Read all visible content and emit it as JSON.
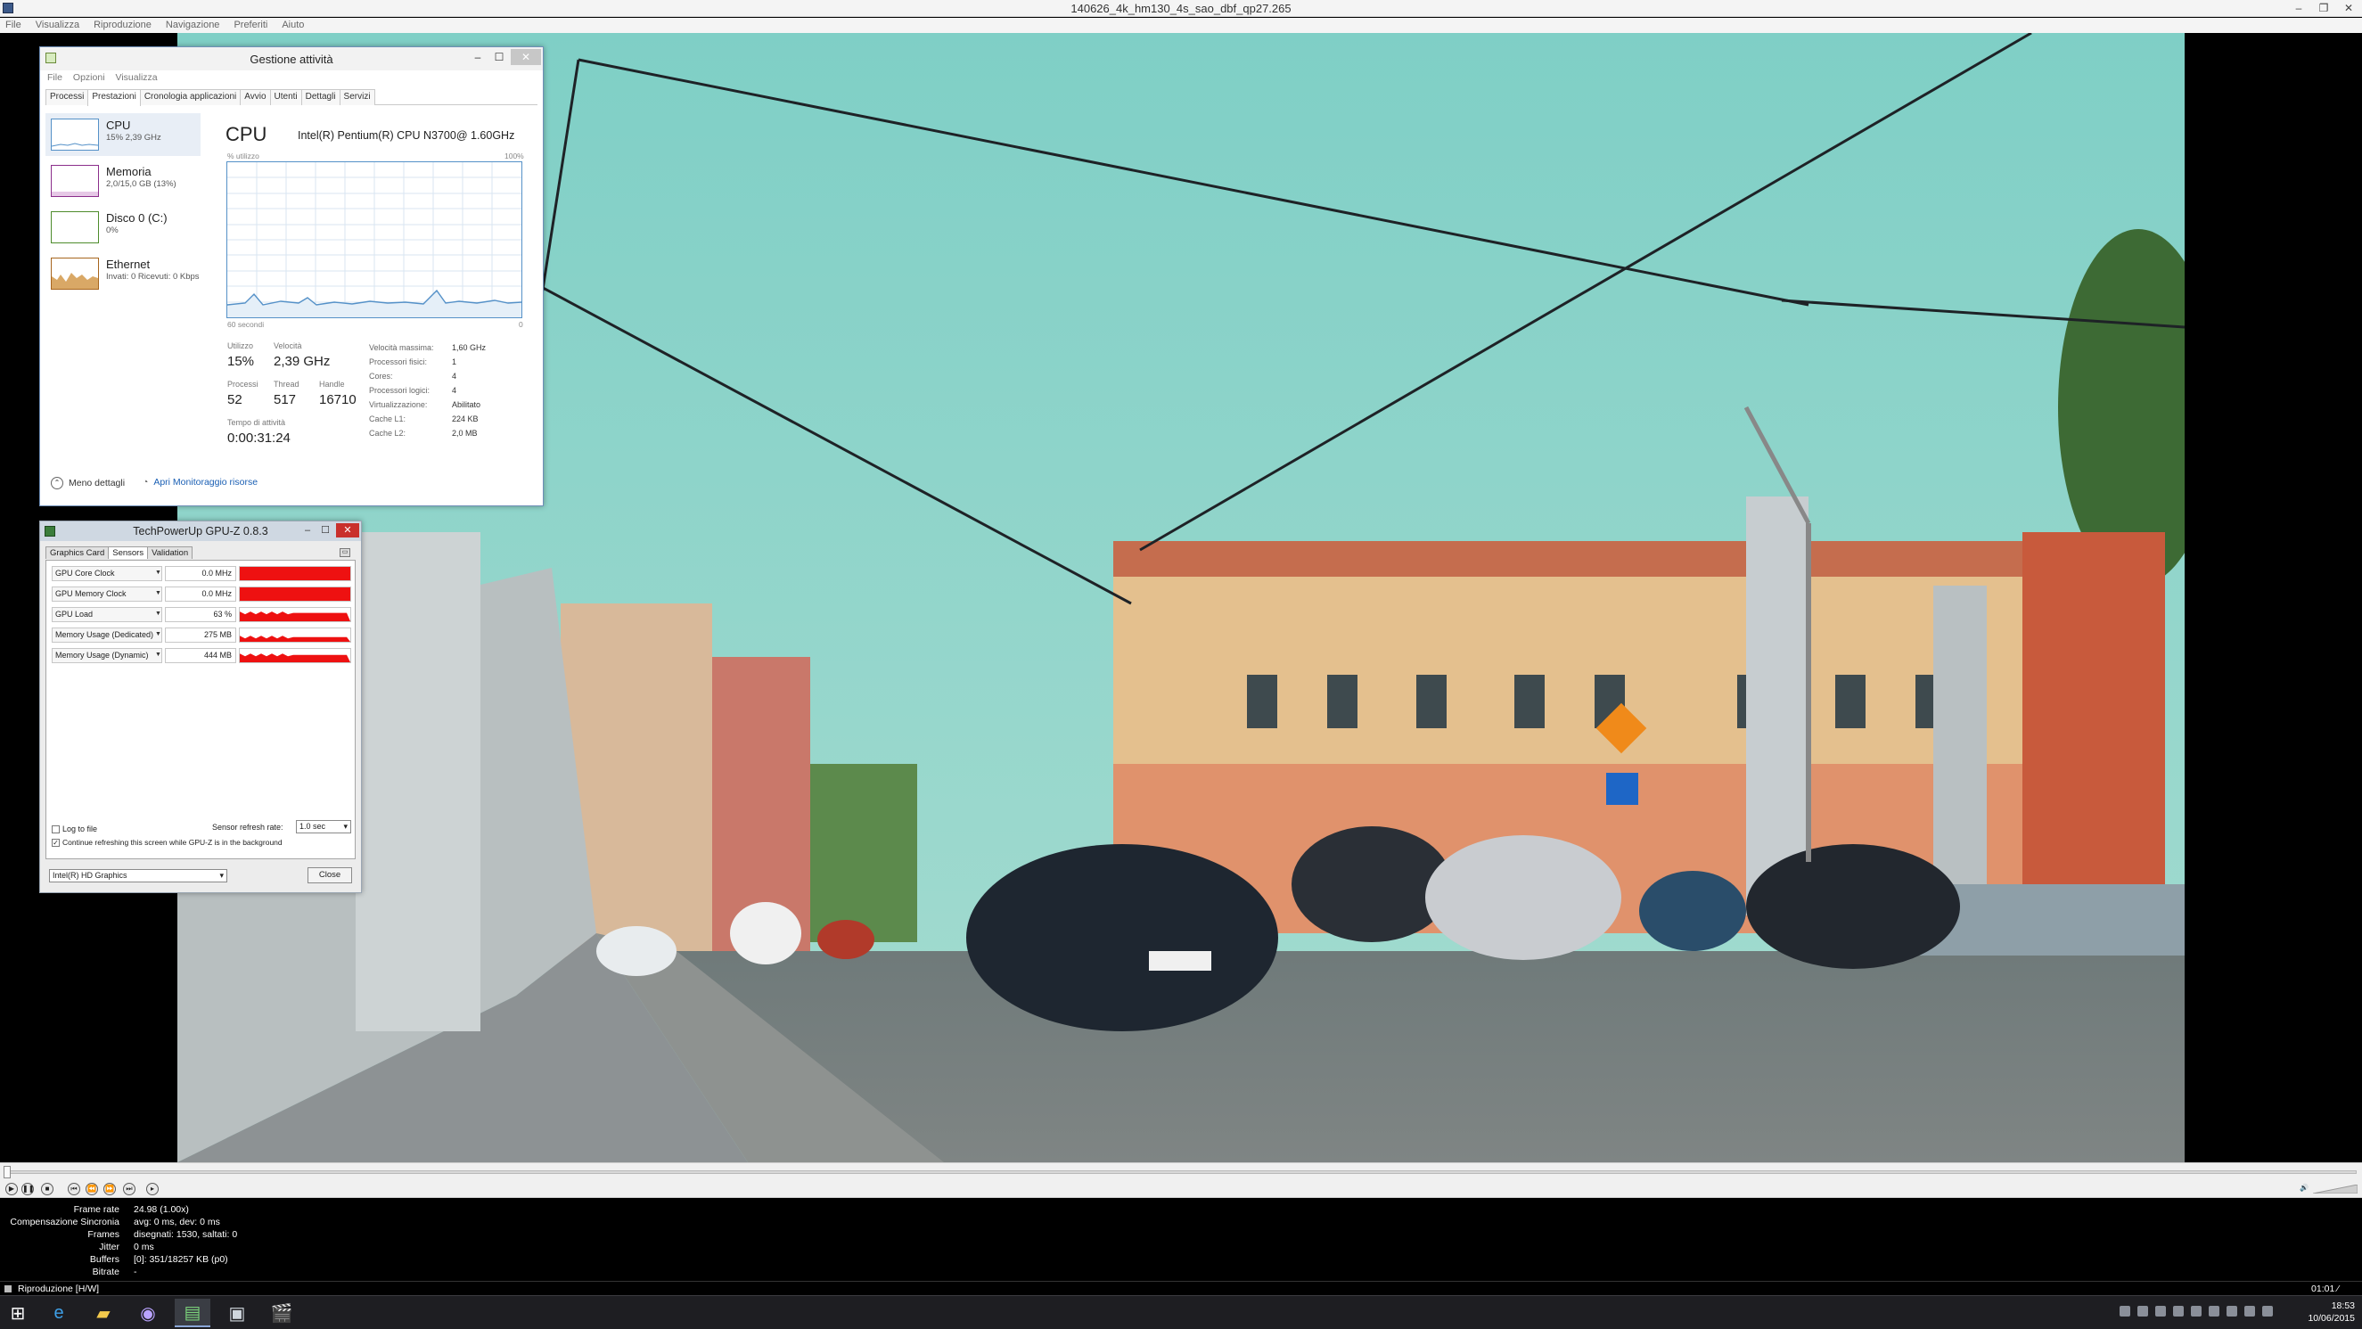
{
  "player": {
    "title": "140626_4k_hm130_4s_sao_dbf_qp27.265",
    "menu": [
      "File",
      "Visualizza",
      "Riproduzione",
      "Navigazione",
      "Preferiti",
      "Aiuto"
    ],
    "stats": [
      {
        "label": "Frame rate",
        "value": "24.98 (1.00x)"
      },
      {
        "label": "Compensazione Sincronia",
        "value": "avg: 0 ms, dev: 0 ms"
      },
      {
        "label": "Frames",
        "value": "disegnati: 1530, saltati: 0"
      },
      {
        "label": "Jitter",
        "value": "0 ms"
      },
      {
        "label": "Buffers",
        "value": "[0]: 351/18257 KB (p0)"
      },
      {
        "label": "Bitrate",
        "value": "-"
      }
    ],
    "status_left": "Riproduzione [H/W]",
    "status_right": "01:01 ⁄"
  },
  "taskmgr": {
    "title": "Gestione attività",
    "menu": [
      "File",
      "Opzioni",
      "Visualizza"
    ],
    "tabs": [
      "Processi",
      "Prestazioni",
      "Cronologia applicazioni",
      "Avvio",
      "Utenti",
      "Dettagli",
      "Servizi"
    ],
    "active_tab": "Prestazioni",
    "side": [
      {
        "name": "CPU",
        "value": "15% 2,39 GHz",
        "color": "#5591c8"
      },
      {
        "name": "Memoria",
        "value": "2,0/15,0 GB (13%)",
        "color": "#8b2e8b"
      },
      {
        "name": "Disco 0 (C:)",
        "value": "0%",
        "color": "#4e8c2c"
      },
      {
        "name": "Ethernet",
        "value": "Invati: 0 Ricevuti: 0 Kbps",
        "color": "#a7651d"
      }
    ],
    "heading": "CPU",
    "cpu_name": "Intel(R) Pentium(R) CPU N3700@ 1.60GHz",
    "graph_ylabel": "% utilizzo",
    "graph_ymax": "100%",
    "graph_xlabel": "60 secondi",
    "graph_xmin": "0",
    "stats": {
      "util_label": "Utilizzo",
      "util": "15%",
      "speed_label": "Velocità",
      "speed": "2,39 GHz",
      "proc_label": "Processi",
      "proc": "52",
      "thread_label": "Thread",
      "thread": "517",
      "handle_label": "Handle",
      "handle": "16710",
      "uptime_label": "Tempo di attività",
      "uptime": "0:00:31:24"
    },
    "details": [
      {
        "k": "Velocità massima:",
        "v": "1,60 GHz"
      },
      {
        "k": "Processori fisici:",
        "v": "1"
      },
      {
        "k": "Cores:",
        "v": "4"
      },
      {
        "k": "Processori logici:",
        "v": "4"
      },
      {
        "k": "Virtualizzazione:",
        "v": "Abilitato"
      },
      {
        "k": "Cache L1:",
        "v": "224 KB"
      },
      {
        "k": "Cache L2:",
        "v": "2,0 MB"
      }
    ],
    "less_details": "Meno dettagli",
    "open_monitor": "Apri Monitoraggio risorse"
  },
  "gpuz": {
    "title": "TechPowerUp GPU-Z 0.8.3",
    "tabs": [
      "Graphics Card",
      "Sensors",
      "Validation"
    ],
    "active_tab": "Sensors",
    "sensors": [
      {
        "name": "GPU Core Clock",
        "value": "0.0 MHz",
        "fill": 1.0
      },
      {
        "name": "GPU Memory Clock",
        "value": "0.0 MHz",
        "fill": 1.0
      },
      {
        "name": "GPU Load",
        "value": "63 %",
        "fill": 0.63
      },
      {
        "name": "Memory Usage (Dedicated)",
        "value": "275 MB",
        "fill": 0.35
      },
      {
        "name": "Memory Usage (Dynamic)",
        "value": "444 MB",
        "fill": 0.55
      }
    ],
    "log_to_file": "Log to file",
    "refresh_label": "Sensor refresh rate:",
    "refresh_value": "1.0 sec",
    "continue_label": "Continue refreshing this screen while GPU-Z is in the background",
    "gpu_select": "Intel(R) HD Graphics",
    "close_label": "Close"
  },
  "taskbar": {
    "apps": [
      "start-icon",
      "ie-icon",
      "explorer-icon",
      "media-player-icon",
      "taskmgr-icon",
      "gpuz-icon",
      "clapper-icon"
    ],
    "time": "18:53",
    "date": "10/06/2015"
  },
  "colors": {
    "sky": "#92d3c9",
    "red_graph": "#ee1111",
    "accent": "#5591c8"
  }
}
